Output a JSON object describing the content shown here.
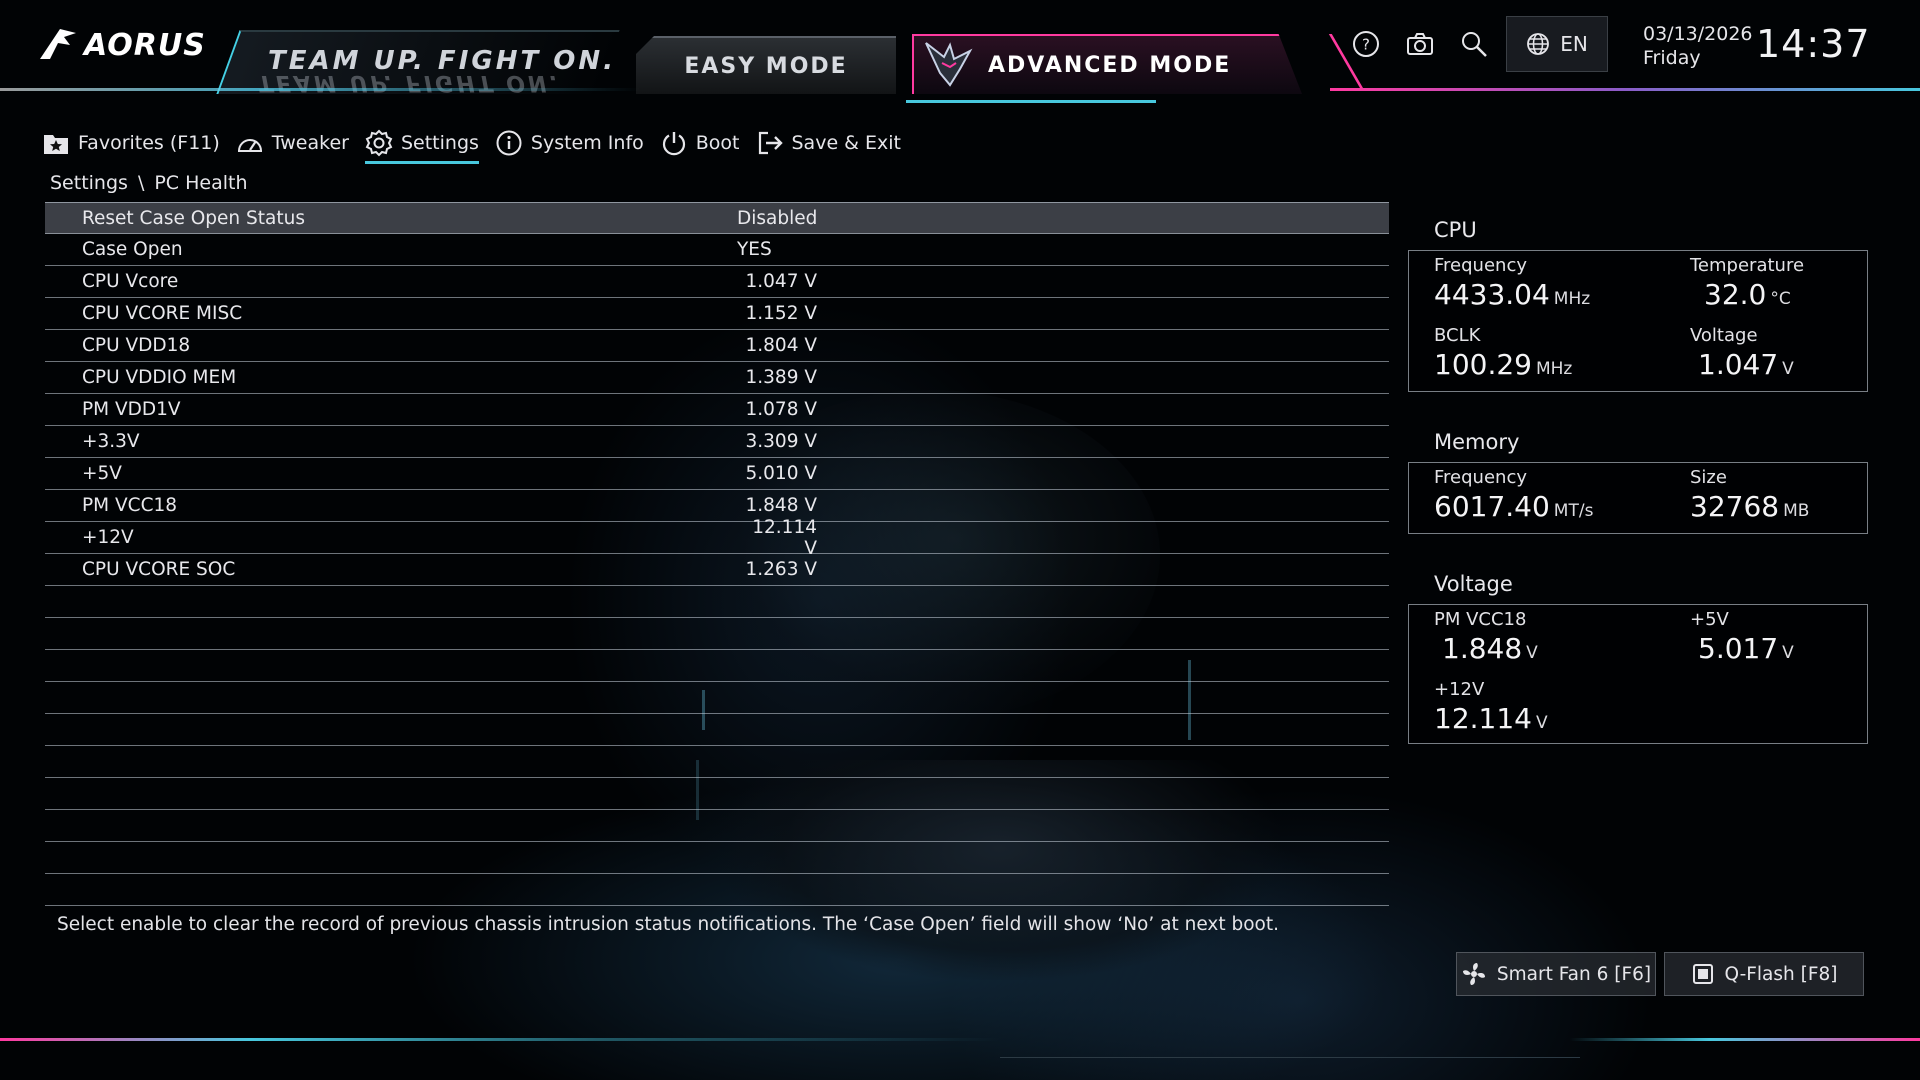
{
  "brand": {
    "logo": "AORUS",
    "slogan": "TEAM UP. FIGHT ON."
  },
  "modes": {
    "easy": "EASY MODE",
    "advanced": "ADVANCED MODE"
  },
  "header": {
    "language": "EN",
    "date": "03/13/2026",
    "day": "Friday",
    "time": "14:37"
  },
  "top_icons": [
    "help-icon",
    "camera-icon",
    "search-icon",
    "globe-icon"
  ],
  "nav": [
    {
      "label": "Favorites (F11)",
      "icon": "star-folder-icon",
      "active": false
    },
    {
      "label": "Tweaker",
      "icon": "speedometer-icon",
      "active": false
    },
    {
      "label": "Settings",
      "icon": "gear-icon",
      "active": true
    },
    {
      "label": "System Info",
      "icon": "info-icon",
      "active": false
    },
    {
      "label": "Boot",
      "icon": "power-icon",
      "active": false
    },
    {
      "label": "Save & Exit",
      "icon": "exit-icon",
      "active": false
    }
  ],
  "breadcrumb": {
    "root": "Settings",
    "separator": "\\",
    "current": "PC Health"
  },
  "rows": [
    {
      "label": "Reset Case Open Status",
      "value": "Disabled"
    },
    {
      "label": "Case Open",
      "value": "YES"
    },
    {
      "label": "CPU Vcore",
      "value": "1.047 V"
    },
    {
      "label": "CPU VCORE MISC",
      "value": "1.152 V"
    },
    {
      "label": "CPU VDD18",
      "value": "1.804 V"
    },
    {
      "label": "CPU VDDIO MEM",
      "value": "1.389 V"
    },
    {
      "label": "PM VDD1V",
      "value": "1.078 V"
    },
    {
      "label": "+3.3V",
      "value": "3.309 V"
    },
    {
      "label": "+5V",
      "value": "5.010 V"
    },
    {
      "label": "PM VCC18",
      "value": "1.848 V"
    },
    {
      "label": "+12V",
      "value": "12.114 V"
    },
    {
      "label": "CPU VCORE SOC",
      "value": "1.263 V"
    },
    {
      "label": "",
      "value": ""
    },
    {
      "label": "",
      "value": ""
    },
    {
      "label": "",
      "value": ""
    },
    {
      "label": "",
      "value": ""
    },
    {
      "label": "",
      "value": ""
    },
    {
      "label": "",
      "value": ""
    },
    {
      "label": "",
      "value": ""
    },
    {
      "label": "",
      "value": ""
    },
    {
      "label": "",
      "value": ""
    },
    {
      "label": "",
      "value": ""
    }
  ],
  "help_text": "Select enable to clear the record of previous chassis intrusion status notifications. The ‘Case Open’ field will show ‘No’ at next boot.",
  "cpu": {
    "title": "CPU",
    "frequency_label": "Frequency",
    "frequency": "4433.04",
    "frequency_unit": "MHz",
    "temperature_label": "Temperature",
    "temperature": "32.0",
    "temperature_unit": "°C",
    "bclk_label": "BCLK",
    "bclk": "100.29",
    "bclk_unit": "MHz",
    "voltage_label": "Voltage",
    "voltage": "1.047",
    "voltage_unit": "V"
  },
  "memory": {
    "title": "Memory",
    "frequency_label": "Frequency",
    "frequency": "6017.40",
    "frequency_unit": "MT/s",
    "size_label": "Size",
    "size": "32768",
    "size_unit": "MB"
  },
  "voltage": {
    "title": "Voltage",
    "pmvcc18_label": "PM VCC18",
    "pmvcc18": "1.848",
    "pmvcc18_unit": "V",
    "p5v_label": "+5V",
    "p5v": "5.017",
    "p5v_unit": "V",
    "p12v_label": "+12V",
    "p12v": "12.114",
    "p12v_unit": "V"
  },
  "buttons": {
    "smart_fan": "Smart Fan 6 [F6]",
    "qflash": "Q-Flash [F8]"
  },
  "colors": {
    "accent_cyan": "#48c8de",
    "accent_pink": "#ff3aa0",
    "selected_row": "#50545c"
  }
}
